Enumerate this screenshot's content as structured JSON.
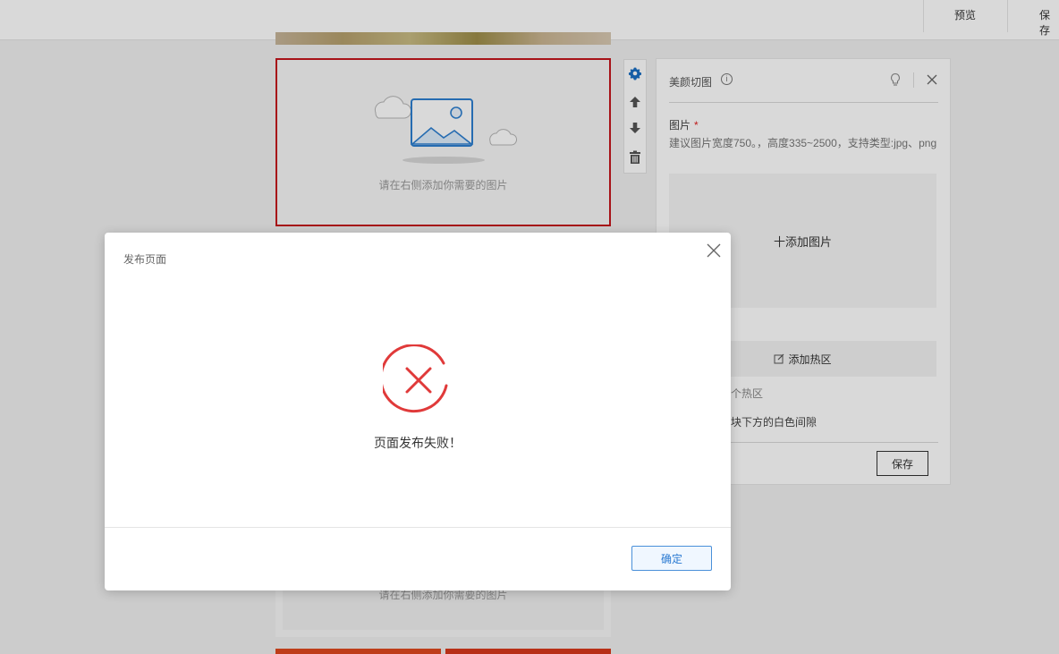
{
  "topbar": {
    "preview_label": "预览",
    "save_label": "保存"
  },
  "canvas": {
    "selected_placeholder": "请在右侧添加你需要的图片",
    "lower_placeholder": "请在右侧添加你需要的图片"
  },
  "tools": {
    "settings": "gear-icon",
    "move_up": "arrow-up-icon",
    "move_down": "arrow-down-icon",
    "delete": "trash-icon"
  },
  "panel": {
    "title": "美颜切图",
    "image_label": "图片",
    "required_mark": "*",
    "hint": "建议图片宽度750。，高度335~2500，支持类型:jpg、png",
    "upload_label": "十添加图片",
    "hotzone_label": "添加热区",
    "hotzone_count": "个热区",
    "gap_label": "块下方的白色间隙",
    "save_label": "保存"
  },
  "modal": {
    "title": "发布页面",
    "message": "页面发布失败！",
    "ok_label": "确定"
  },
  "colors": {
    "selected_border": "#c5161d",
    "error": "#e03a3a",
    "primary": "#2a7ad2",
    "tool_icon": "#1a6fc4"
  }
}
